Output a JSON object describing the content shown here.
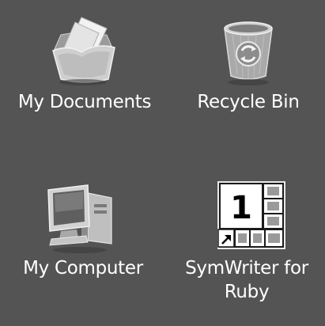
{
  "desktop": {
    "icons": [
      {
        "label": "My Documents",
        "icon": "folder-documents-icon"
      },
      {
        "label": "Recycle Bin",
        "icon": "recycle-bin-icon"
      },
      {
        "label": "My Computer",
        "icon": "computer-icon"
      },
      {
        "label": "SymWriter for\nRuby",
        "icon": "symwriter-grid-icon",
        "glyph": "1",
        "shortcut_overlay": "shortcut-arrow-icon"
      }
    ]
  }
}
